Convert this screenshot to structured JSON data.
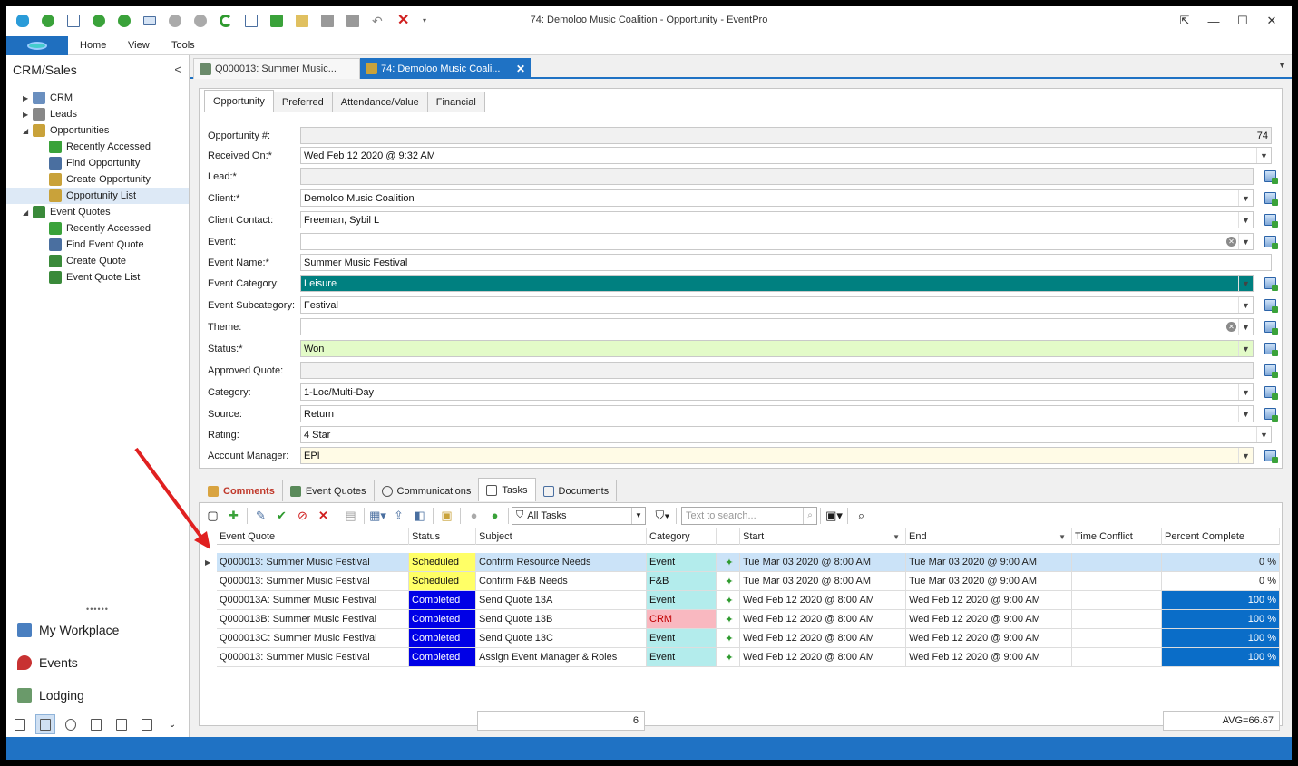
{
  "window": {
    "title": "74: Demoloo Music Coalition - Opportunity - EventPro"
  },
  "ribbon": {
    "tabs": [
      "Home",
      "View",
      "Tools"
    ]
  },
  "sidebar": {
    "title": "CRM/Sales",
    "tree": [
      {
        "label": "CRM",
        "level": 0,
        "exp": "▶",
        "color": "#6a8fbf"
      },
      {
        "label": "Leads",
        "level": 0,
        "exp": "▶",
        "color": "#888888"
      },
      {
        "label": "Opportunities",
        "level": 0,
        "exp": "◢",
        "color": "#c9a23a"
      },
      {
        "label": "Recently Accessed",
        "level": 1,
        "exp": "",
        "color": "#3aa23a"
      },
      {
        "label": "Find Opportunity",
        "level": 1,
        "exp": "",
        "color": "#4a6fa0"
      },
      {
        "label": "Create Opportunity",
        "level": 1,
        "exp": "",
        "color": "#c9a23a"
      },
      {
        "label": "Opportunity List",
        "level": 1,
        "exp": "",
        "color": "#c9a23a",
        "selected": true
      },
      {
        "label": "Event Quotes",
        "level": 0,
        "exp": "◢",
        "color": "#3a8a3a"
      },
      {
        "label": "Recently Accessed",
        "level": 1,
        "exp": "",
        "color": "#3aa23a"
      },
      {
        "label": "Find Event Quote",
        "level": 1,
        "exp": "",
        "color": "#4a6fa0"
      },
      {
        "label": "Create Quote",
        "level": 1,
        "exp": "",
        "color": "#3a8a3a"
      },
      {
        "label": "Event Quote List",
        "level": 1,
        "exp": "",
        "color": "#3a8a3a"
      }
    ],
    "nav": [
      "My Workplace",
      "Events",
      "Lodging"
    ]
  },
  "doc_tabs": [
    {
      "label": "Q000013: Summer Music..."
    },
    {
      "label": "74: Demoloo Music Coali..."
    }
  ],
  "form_tabs": [
    "Opportunity",
    "Preferred",
    "Attendance/Value",
    "Financial"
  ],
  "fields": [
    {
      "label": "Opportunity #:",
      "value": "74",
      "ro": true,
      "align": "right",
      "dd": false,
      "btn": false
    },
    {
      "label": "Received On:*",
      "value": "Wed Feb 12 2020 @ 9:32 AM",
      "dd": true,
      "btn": false
    },
    {
      "label": "Lead:*",
      "value": "",
      "ro": true,
      "dd": false,
      "btn": true
    },
    {
      "label": "Client:*",
      "value": "Demoloo Music Coalition",
      "dd": true,
      "btn": true
    },
    {
      "label": "Client Contact:",
      "value": "Freeman, Sybil L",
      "dd": true,
      "btn": true
    },
    {
      "label": "Event:",
      "value": "",
      "dd": true,
      "btn": true,
      "clear": true
    },
    {
      "label": "Event Name:*",
      "value": "Summer Music Festival",
      "dd": false,
      "btn": false
    },
    {
      "label": "Event Category:",
      "value": "Leisure",
      "dd": true,
      "btn": true,
      "bg": "#008080",
      "fg": "#ffffff"
    },
    {
      "label": "Event Subcategory:",
      "value": "Festival",
      "dd": true,
      "btn": true
    },
    {
      "label": "Theme:",
      "value": "",
      "dd": true,
      "btn": true,
      "clear": true
    },
    {
      "label": "Status:*",
      "value": "Won",
      "dd": true,
      "btn": true,
      "bg": "#e3fbc8"
    },
    {
      "label": "Approved Quote:",
      "value": "",
      "ro": true,
      "dd": false,
      "btn": true
    },
    {
      "label": "Category:",
      "value": "1-Loc/Multi-Day",
      "dd": true,
      "btn": true
    },
    {
      "label": "Source:",
      "value": "Return",
      "dd": true,
      "btn": true
    },
    {
      "label": "Rating:",
      "value": "4 Star",
      "dd": true,
      "btn": false
    },
    {
      "label": "Account Manager:",
      "value": "EPI",
      "dd": true,
      "btn": true,
      "bg": "#fffbe6"
    }
  ],
  "bottom_tabs": [
    "Comments",
    "Event Quotes",
    "Communications",
    "Tasks",
    "Documents"
  ],
  "toolbar": {
    "filter_value": "All Tasks",
    "search_placeholder": "Text to search..."
  },
  "grid": {
    "columns": [
      "Event Quote",
      "Status",
      "Subject",
      "Category",
      "",
      "Start",
      "End",
      "Time Conflict",
      "Percent Complete"
    ],
    "rows": [
      {
        "quote": "Q000013: Summer Music Festival",
        "status": "Scheduled",
        "subject": "Confirm Resource Needs",
        "category": "Event",
        "start": "Tue Mar 03 2020 @ 8:00 AM",
        "end": "Tue Mar 03 2020 @ 9:00 AM",
        "conflict": "",
        "percent": "0 %",
        "pct_fill": 0
      },
      {
        "quote": "Q000013: Summer Music Festival",
        "status": "Scheduled",
        "subject": "Confirm F&B Needs",
        "category": "F&B",
        "start": "Tue Mar 03 2020 @ 8:00 AM",
        "end": "Tue Mar 03 2020 @ 9:00 AM",
        "conflict": "",
        "percent": "0 %",
        "pct_fill": 0
      },
      {
        "quote": "Q000013A: Summer Music Festival",
        "status": "Completed",
        "subject": "Send Quote 13A",
        "category": "Event",
        "start": "Wed Feb 12 2020 @ 8:00 AM",
        "end": "Wed Feb 12 2020 @ 9:00 AM",
        "conflict": "",
        "percent": "100 %",
        "pct_fill": 1
      },
      {
        "quote": "Q000013B: Summer Music Festival",
        "status": "Completed",
        "subject": "Send Quote 13B",
        "category": "CRM",
        "start": "Wed Feb 12 2020 @ 8:00 AM",
        "end": "Wed Feb 12 2020 @ 9:00 AM",
        "conflict": "",
        "percent": "100 %",
        "pct_fill": 1
      },
      {
        "quote": "Q000013C: Summer Music Festival",
        "status": "Completed",
        "subject": "Send Quote 13C",
        "category": "Event",
        "start": "Wed Feb 12 2020 @ 8:00 AM",
        "end": "Wed Feb 12 2020 @ 9:00 AM",
        "conflict": "",
        "percent": "100 %",
        "pct_fill": 1
      },
      {
        "quote": "Q000013: Summer Music Festival",
        "status": "Completed",
        "subject": "Assign Event Manager & Roles",
        "category": "Event",
        "start": "Wed Feb 12 2020 @ 8:00 AM",
        "end": "Wed Feb 12 2020 @ 9:00 AM",
        "conflict": "",
        "percent": "100 %",
        "pct_fill": 1
      }
    ],
    "count": "6",
    "avg": "AVG=66.67"
  },
  "colors": {
    "accent": "#1f72c4",
    "scheduled": "#ffff66",
    "completed": "#0000e6",
    "category_event": "#b3ecec",
    "category_crm": "#f9b8c0",
    "percent_fill": "#0a6dc8",
    "selected_row": "#cbe3f8"
  }
}
